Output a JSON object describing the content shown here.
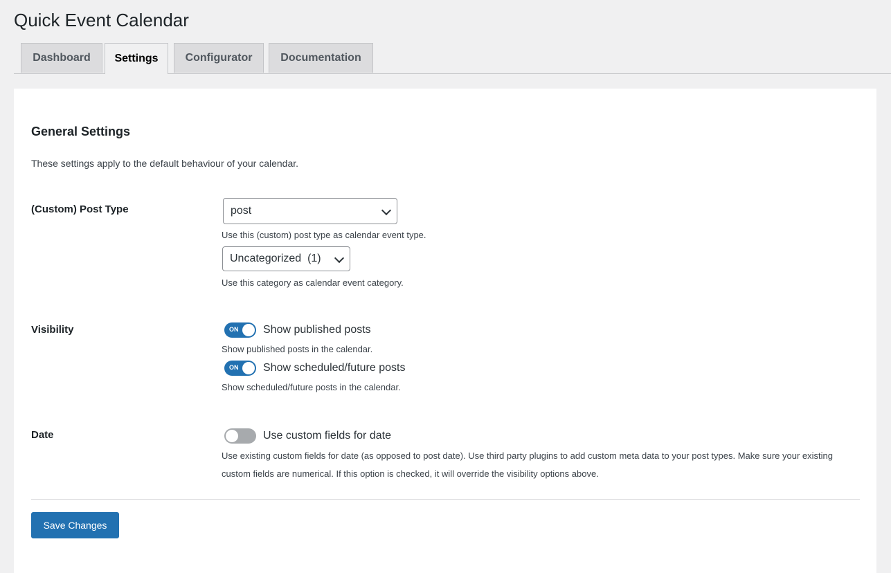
{
  "page": {
    "title": "Quick Event Calendar"
  },
  "tabs": [
    {
      "label": "Dashboard",
      "active": false
    },
    {
      "label": "Settings",
      "active": true
    },
    {
      "label": "Configurator",
      "active": false
    },
    {
      "label": "Documentation",
      "active": false
    }
  ],
  "general": {
    "title": "General Settings",
    "intro": "These settings apply to the default behaviour of your calendar."
  },
  "post_type": {
    "label": "(Custom) Post Type",
    "select_value": "post",
    "select_help": "Use this (custom) post type as calendar event type.",
    "category_value": "Uncategorized  (1)",
    "category_help": "Use this category as calendar event category."
  },
  "visibility": {
    "label": "Visibility",
    "toggles": [
      {
        "label": "Show published posts",
        "state": "on",
        "on_text": "ON",
        "help": "Show published posts in the calendar."
      },
      {
        "label": "Show scheduled/future posts",
        "state": "on",
        "on_text": "ON",
        "help": "Show scheduled/future posts in the calendar."
      }
    ]
  },
  "date": {
    "label": "Date",
    "toggle_label": "Use custom fields for date",
    "state": "off",
    "help": "Use existing custom fields for date (as opposed to post date). Use third party plugins to add custom meta data to your post types. Make sure your existing custom fields are numerical. If this option is checked, it will override the visibility options above."
  },
  "actions": {
    "save_label": "Save Changes"
  },
  "colors": {
    "accent": "#2271b1",
    "toggle_off": "#a7aaad",
    "background": "#f0f0f1"
  }
}
